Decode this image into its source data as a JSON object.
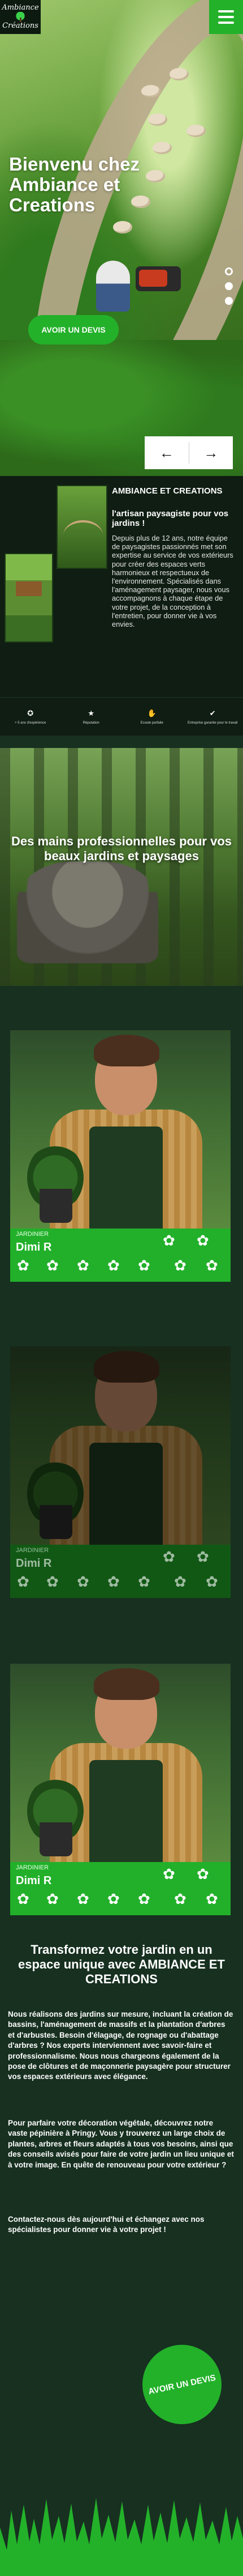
{
  "header": {
    "logo_line1": "Ambiance",
    "logo_line2": "Créations",
    "menu_icon": "hamburger-icon"
  },
  "hero": {
    "title": "Bienvenu chez Ambiance et Creations",
    "cta_label": "AVOIR UN DEVIS",
    "slide_count": 3,
    "active_slide": 1,
    "prev_arrow": "←",
    "next_arrow": "→"
  },
  "intro": {
    "heading": "AMBIANCE ET CREATIONS",
    "subheading": "l'artisan paysagiste pour vos jardins !",
    "text": "Depuis plus de 12 ans, notre équipe de paysagistes passionnés met son expertise au service de vos extérieurs pour créer des espaces verts harmonieux et respectueux de l'environnement. Spécialisés dans l'aménagement paysager, nous vous accompagnons à chaque étape de votre projet, de la conception à l'entretien, pour donner vie à vos envies."
  },
  "features": [
    {
      "icon": "badge-icon",
      "label": "+ 5 ans d'expérience"
    },
    {
      "icon": "star-icon",
      "label": "Réputation"
    },
    {
      "icon": "thumbs-up-icon",
      "label": "Ecoute parfaite"
    },
    {
      "icon": "check-icon",
      "label": "Entreprise garantie pour le travail"
    }
  ],
  "forest": {
    "title": "Des mains professionnelles pour vos beaux jardins et paysages"
  },
  "team": [
    {
      "role": "JARDINIER",
      "name": "Dimi  R",
      "dimmed": false
    },
    {
      "role": "JARDINIER",
      "name": "Dimi  R",
      "dimmed": true
    },
    {
      "role": "JARDINIER",
      "name": "Dimi  R",
      "dimmed": false
    }
  ],
  "cta": {
    "title": "Transformez votre jardin en un espace unique avec AMBIANCE ET CREATIONS",
    "para1": "Nous réalisons des jardins sur mesure, incluant la création de bassins, l'aménagement de massifs et la plantation d'arbres et d'arbustes. Besoin d'élagage, de rognage ou d'abattage d'arbres ? Nos experts interviennent avec savoir-faire et professionnalisme. Nous nous chargeons également de la pose de clôtures et de maçonnerie paysagère pour structurer vos espaces extérieurs avec élégance.",
    "para2": "Pour parfaire votre décoration végétale, découvrez notre vaste pépinière à Pringy. Vous y trouverez un large choix de plantes, arbres et fleurs adaptés à tous vos besoins, ainsi que des conseils avisés pour faire de votre jardin un lieu unique et à votre image. En quête de renouveau pour votre extérieur ?",
    "para3": "Contactez-nous dès aujourd'hui et échangez avec nos spécialistes pour donner vie à votre projet !",
    "round_button": "AVOIR UN DEVIS"
  },
  "colors": {
    "accent_green": "#23b12a",
    "background": "#173020",
    "dark_panel": "#0f1d12"
  }
}
